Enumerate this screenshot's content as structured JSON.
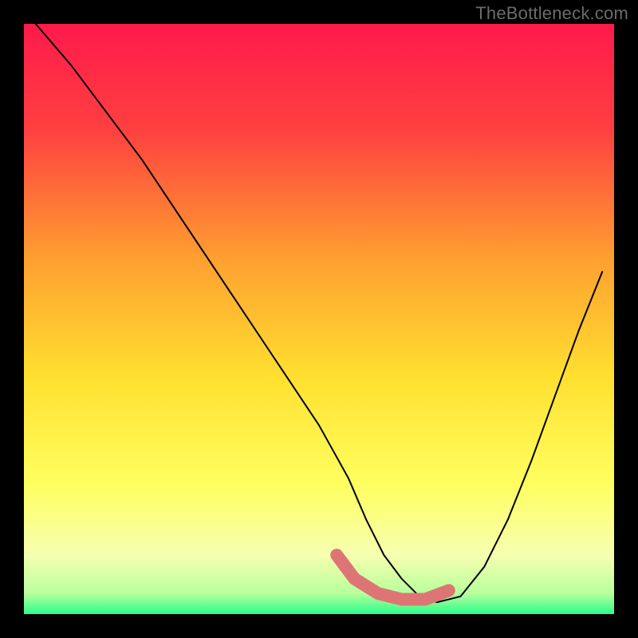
{
  "attribution": "TheBottleneck.com",
  "chart_data": {
    "type": "line",
    "title": "",
    "xlabel": "",
    "ylabel": "",
    "xlim": [
      0,
      100
    ],
    "ylim": [
      0,
      100
    ],
    "background_gradient": {
      "stops": [
        {
          "offset": 0.0,
          "color": "#ff1a4b"
        },
        {
          "offset": 0.18,
          "color": "#ff4040"
        },
        {
          "offset": 0.4,
          "color": "#ffa030"
        },
        {
          "offset": 0.6,
          "color": "#ffe030"
        },
        {
          "offset": 0.78,
          "color": "#ffff60"
        },
        {
          "offset": 0.9,
          "color": "#f6ffb0"
        },
        {
          "offset": 0.965,
          "color": "#b8ff9c"
        },
        {
          "offset": 1.0,
          "color": "#2aff8a"
        }
      ]
    },
    "series": [
      {
        "name": "bottleneck-curve",
        "x": [
          2,
          8,
          14,
          20,
          26,
          32,
          38,
          44,
          50,
          55,
          58,
          61,
          64,
          67,
          70,
          74,
          78,
          82,
          86,
          90,
          94,
          98
        ],
        "y": [
          100,
          93,
          85,
          77,
          68,
          59,
          50,
          41,
          32,
          23,
          16,
          10,
          6,
          3,
          2,
          3,
          8,
          16,
          26,
          37,
          48,
          58
        ]
      }
    ],
    "flat_region": {
      "name": "optimal-range-marker",
      "color": "#dd7575",
      "points_xy": [
        [
          53,
          10
        ],
        [
          56,
          6
        ],
        [
          60,
          3.5
        ],
        [
          64,
          2.5
        ],
        [
          68,
          2.5
        ],
        [
          72,
          4
        ]
      ]
    }
  }
}
